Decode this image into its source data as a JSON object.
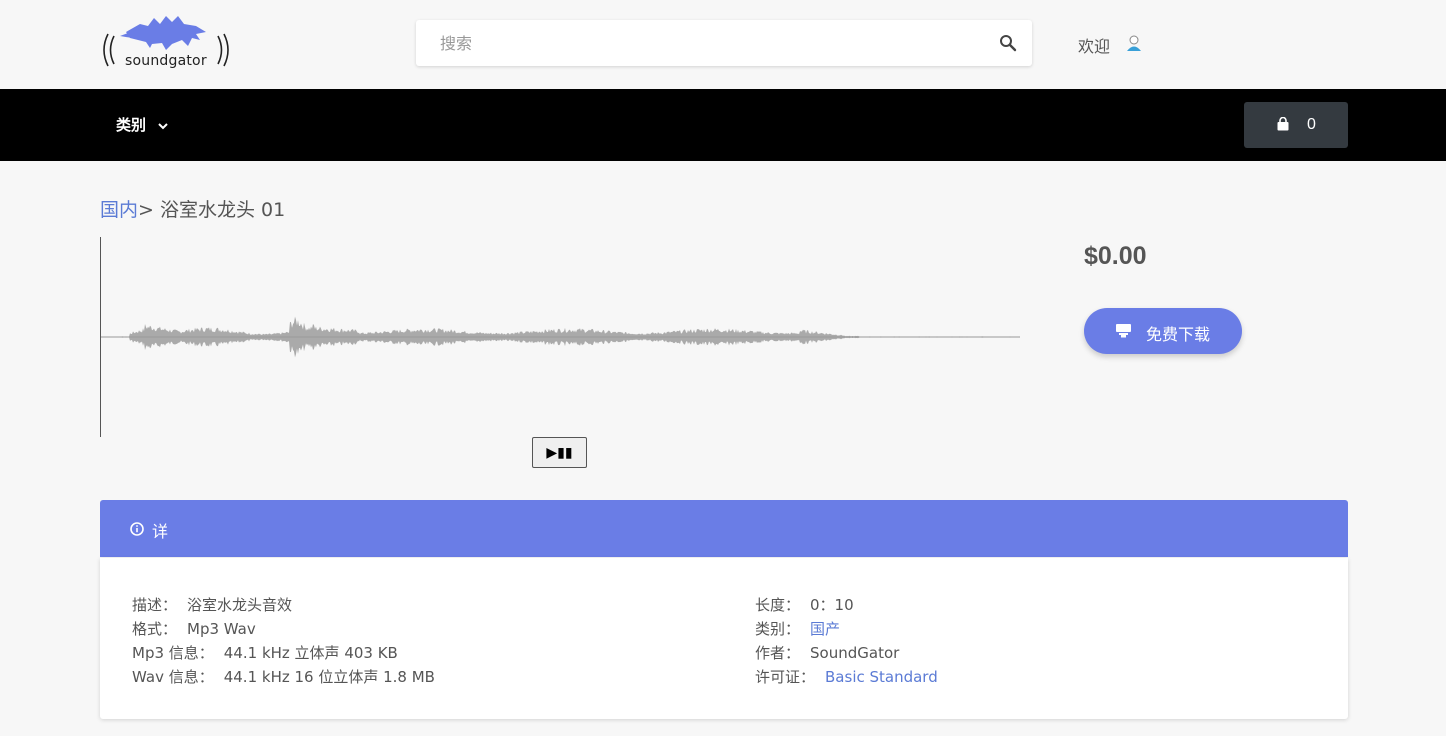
{
  "brand": {
    "logo_text": "soundgator",
    "accent": "#6a7de6"
  },
  "search": {
    "placeholder": "搜索",
    "value": ""
  },
  "header": {
    "welcome": "欢迎"
  },
  "nav": {
    "category_label": "类别",
    "cart_count": "0"
  },
  "breadcrumb": {
    "parent": "国内",
    "separator": ">",
    "current": "浴室水龙头 01"
  },
  "player": {
    "play_pause_label": "▶▮▮"
  },
  "product": {
    "price": "$0.00",
    "download_label": "免费下载"
  },
  "details": {
    "title": "详",
    "left": [
      {
        "key": "描述：",
        "value": "浴室水龙头音效",
        "link": false
      },
      {
        "key": "格式：",
        "value": "Mp3 Wav",
        "link": false
      },
      {
        "key": "Mp3 信息：",
        "value": "44.1 kHz 立体声 403 KB",
        "link": false
      },
      {
        "key": "Wav 信息：",
        "value": "44.1 kHz 16 位立体声 1.8 MB",
        "link": false
      }
    ],
    "right": [
      {
        "key": "长度：",
        "value": "0：10",
        "link": false
      },
      {
        "key": "类别：",
        "value": "国产",
        "link": true
      },
      {
        "key": "作者：",
        "value": "SoundGator",
        "link": false
      },
      {
        "key": "许可证：",
        "value": "Basic Standard",
        "link": true
      }
    ]
  }
}
